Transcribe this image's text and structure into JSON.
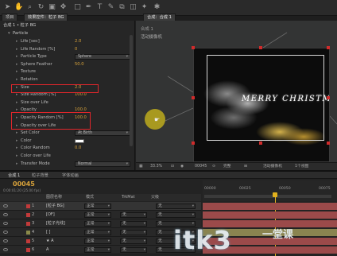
{
  "tabs": {
    "project": "项目",
    "effects": "效果控件：粒子 BG",
    "composition": "合成：合成 1",
    "sub_tab": "合成 1"
  },
  "effect_panel": {
    "header": "合成 1 • 粒子 BG",
    "section": "Particle",
    "rows": [
      {
        "name": "Life [sec]",
        "value": "2.0"
      },
      {
        "name": "Life Random [%]",
        "value": "0"
      },
      {
        "name": "Particle Type",
        "value": "Sphere",
        "dropdown": true
      },
      {
        "name": "Sphere Feather",
        "value": "50.0"
      },
      {
        "name": "Texture",
        "value": ""
      },
      {
        "name": "Rotation",
        "value": ""
      },
      {
        "name": "Size",
        "value": "2.0"
      },
      {
        "name": "Size Random [%]",
        "value": "100.0"
      },
      {
        "name": "Size over Life",
        "value": ""
      },
      {
        "name": "Opacity",
        "value": "100.0"
      },
      {
        "name": "Opacity Random [%]",
        "value": "100.0"
      },
      {
        "name": "Opacity over Life",
        "value": ""
      },
      {
        "name": "Set Color",
        "value": "At Birth",
        "dropdown": true
      },
      {
        "name": "Color",
        "value": ""
      },
      {
        "name": "Color Random",
        "value": "0.0"
      },
      {
        "name": "Color over Life",
        "value": ""
      },
      {
        "name": "Transfer Mode",
        "value": "Normal",
        "dropdown": true
      }
    ]
  },
  "viewer": {
    "label": "活动摄像机",
    "canvas_text": "MERRY CHRISTMAS",
    "zoom": "33.3%",
    "timecode": "00045",
    "resolution": "完整",
    "camera": "活动摄像机",
    "views": "1个视图"
  },
  "timeline": {
    "tabs": [
      "合成 1",
      "粒子背景",
      "字体动画"
    ],
    "current_time": "00045",
    "time_sub": "0:00:01:20 (25.00 fps)",
    "columns": {
      "name": "图层名称",
      "mode": "模式",
      "trkmat": "TrkMat",
      "parent": "父级"
    },
    "ruler": [
      "00000",
      "00025",
      "00050",
      "00075"
    ],
    "layers": [
      {
        "num": "1",
        "name": "[粒子 BG]",
        "mode": "正常",
        "trkmat": "",
        "parent": "无",
        "color": "#c23a3a"
      },
      {
        "num": "2",
        "name": "[OF]",
        "mode": "正常",
        "trkmat": "无",
        "parent": "无",
        "color": "#c23a3a"
      },
      {
        "num": "3",
        "name": "[粒子光线]",
        "mode": "正常",
        "trkmat": "无",
        "parent": "无",
        "color": "#c23a3a"
      },
      {
        "num": "4",
        "name": "[  ]",
        "mode": "正常",
        "trkmat": "无",
        "parent": "无",
        "color": "#8a8a4a"
      },
      {
        "num": "5",
        "name": "★ A",
        "mode": "正常",
        "trkmat": "无",
        "parent": "无",
        "color": "#c23a3a"
      },
      {
        "num": "6",
        "name": "A",
        "mode": "正常",
        "trkmat": "无",
        "parent": "无",
        "color": "#c23a3a"
      }
    ]
  },
  "watermark": {
    "text": "itk3",
    "sub": "一堂课"
  },
  "colors": {
    "highlight": "#e0262b",
    "value": "#d9a33b",
    "cursor": "#b5a41e"
  }
}
